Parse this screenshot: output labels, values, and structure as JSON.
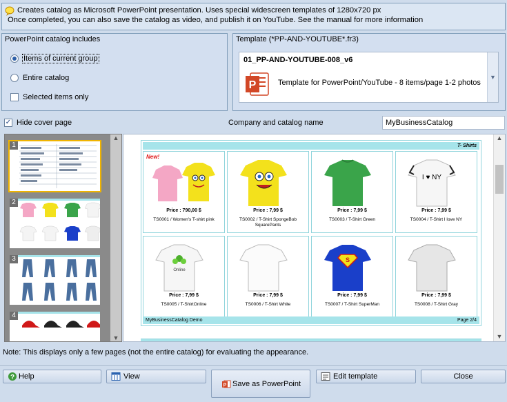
{
  "info": {
    "line1": "Creates catalog as Microsoft PowerPoint presentation. Uses special widescreen templates of 1280x720 px",
    "line2": "Once completed, you can also save the catalog as video, and publish it on YouTube. See the manual for more information"
  },
  "catalog_includes": {
    "title": "PowerPoint catalog includes",
    "options": [
      {
        "label": "Items of current group",
        "selected": true
      },
      {
        "label": "Entire catalog",
        "selected": false
      }
    ],
    "selected_only": {
      "label": "Selected items only",
      "checked": false
    }
  },
  "template": {
    "title": "Template (*PP-AND-YOUTUBE*.fr3)",
    "name": "01_PP-AND-YOUTUBE-008_v6",
    "description": "Template for PowerPoint/YouTube - 8 items/page 1-2 photos"
  },
  "hide_cover": {
    "label": "Hide cover page",
    "checked": true
  },
  "company": {
    "label": "Company and catalog name",
    "value": "MyBusinessCatalog"
  },
  "thumbnails": [
    "1",
    "2",
    "3",
    "4"
  ],
  "preview": {
    "header": "T- Shirts",
    "footer_left": "MyBusinessCatalog Demo",
    "footer_right": "Page 2/4",
    "new_badge": "New!",
    "items": [
      {
        "price": "Price   :  790,00 $",
        "code": "TS0001  /  Women's T-shirt pink"
      },
      {
        "price": "Price   :  7,99 $",
        "code": "TS0002  /  T-Shirt SpongeBob SquarePants"
      },
      {
        "price": "Price   :  7,99 $",
        "code": "TS0003  /  T-Shirt Green"
      },
      {
        "price": "Price   :  7,99 $",
        "code": "TS0004  /  T-Shirt I love NY"
      },
      {
        "price": "Price   :  7,99 $",
        "code": "TS0005  /  T-ShirtOnline"
      },
      {
        "price": "Price   :  7,99 $",
        "code": "TS0006  /  T-Shirt White"
      },
      {
        "price": "Price   :  7,99 $",
        "code": "TS0007  /  T-Shirt SuperMan"
      },
      {
        "price": "Price   :  7,99 $",
        "code": "TS0008  /  T-Shirt Gray"
      }
    ],
    "tshirt_ny_text": "I ♥ NY",
    "tshirt_online_text": "Online"
  },
  "note": "Note: This displays only a few pages (not the entire catalog) for evaluating the appearance.",
  "buttons": {
    "help": "Help",
    "view": "View",
    "save": "Save as PowerPoint",
    "edit": "Edit template",
    "close": "Close"
  }
}
